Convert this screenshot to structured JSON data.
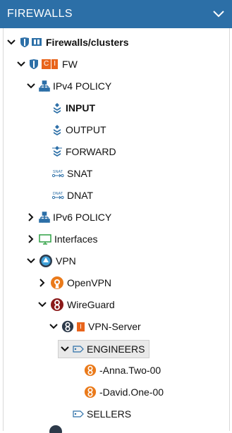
{
  "header": {
    "title": "FIREWALLS"
  },
  "tree": {
    "root": "Firewalls/clusters",
    "fw": {
      "label": "FW",
      "badge_c": "C",
      "badge_i": "I"
    },
    "ipv4": "IPv4 POLICY",
    "input": "INPUT",
    "output": "OUTPUT",
    "forward": "FORWARD",
    "snat": "SNAT",
    "dnat": "DNAT",
    "ipv6": "IPv6 POLICY",
    "interfaces": "Interfaces",
    "vpn": "VPN",
    "openvpn": "OpenVPN",
    "wireguard": "WireGuard",
    "vpn_server": {
      "label": "VPN-Server",
      "badge": "I"
    },
    "engineers": "ENGINEERS",
    "anna": "-Anna.Two-00",
    "david": "-David.One-00",
    "sellers": "SELLERS",
    "snat_icon_text": "SNAT",
    "dnat_icon_text": "DNAT"
  },
  "colors": {
    "header_bg": "#2c6fa7",
    "accent_blue": "#2c6fa7",
    "orange": "#e8641b",
    "wireguard_red": "#8b1a1a"
  },
  "icons": {
    "collapse_header": "chevron-down-icon",
    "firewall": "shield-icon",
    "policy": "hierarchy-icon",
    "rules": "stack-icon",
    "nat": "nat-arrows-icon",
    "interfaces": "monitor-icon",
    "vpn": "vpn-globe-icon",
    "openvpn": "openvpn-icon",
    "wireguard": "wireguard-icon",
    "tag": "tag-icon"
  }
}
